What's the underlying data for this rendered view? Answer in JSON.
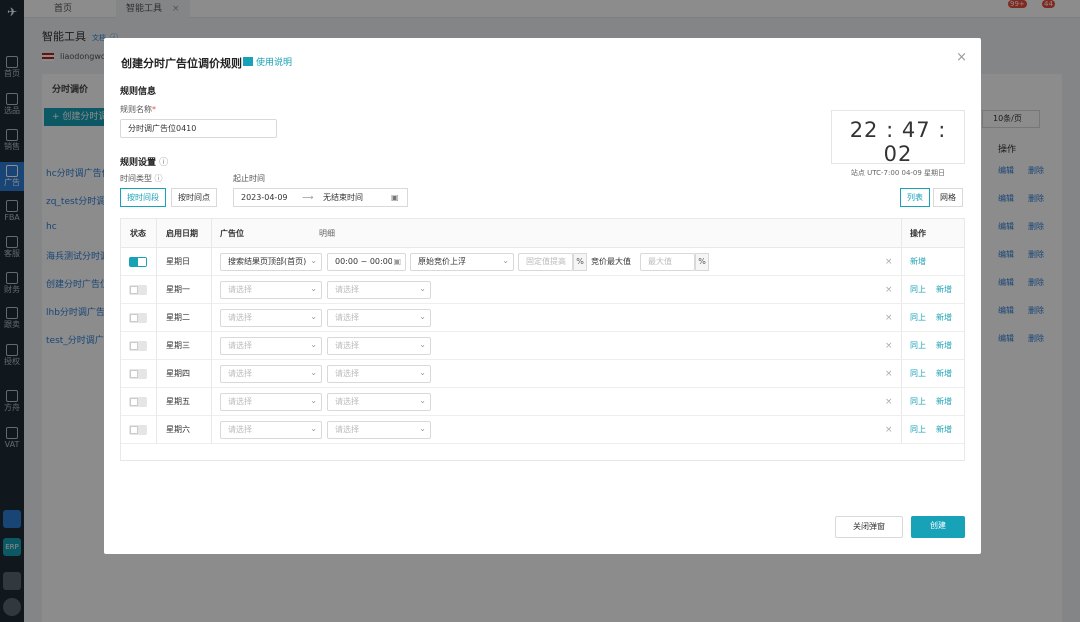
{
  "sidebar": {
    "items": [
      "首页",
      "选品",
      "销售",
      "广告",
      "FBA",
      "客服",
      "财务",
      "跟卖",
      "授权",
      "方舟",
      "VAT"
    ],
    "apps": [
      "ERP"
    ]
  },
  "tabs": [
    {
      "label": "首页"
    },
    {
      "label": "智能工具",
      "close": "×"
    }
  ],
  "badges": [
    "99+",
    "44"
  ],
  "background": {
    "title": "智能工具",
    "doc": "文档",
    "account": "liaodongwo",
    "card_title": "分时调价",
    "create": "+ 创建分时调",
    "rows": [
      "hc分时调广告位",
      "zq_test分时调",
      "hc",
      "海兵测试分时调",
      "创建分时广告位",
      "lhb分时调广告位",
      "test_分时调广告"
    ],
    "pager": "10条/页",
    "ops_header": "操作",
    "edit": "编辑",
    "delete": "删除"
  },
  "modal": {
    "title": "创建分时广告位调价规则",
    "help": "使用说明",
    "close": "×",
    "section_info": "规则信息",
    "name_label": "规则名称",
    "required_mark": "*",
    "name_value": "分时调广告位0410",
    "section_settings": "规则设置",
    "time_type_label": "时间类型",
    "period_label": "起止时间",
    "time_types": [
      "按时间段",
      "按时间点"
    ],
    "start_date": "2023-04-09",
    "arrow": "⟶",
    "end_date": "无结束时间",
    "clock": {
      "time": "22 : 47 : 02",
      "zone": "站点 UTC-7:00  04-09 星期日"
    },
    "view_modes": [
      "列表",
      "网格"
    ],
    "table": {
      "headers": {
        "status": "状态",
        "date": "启用日期",
        "placement": "广告位",
        "detail": "明细",
        "ops": "操作"
      },
      "first_row": {
        "day": "星期日",
        "placement": "搜索结果页顶部(首页)",
        "time": "00:00 ~ 00:00",
        "strategy": "原始竞价上浮",
        "fixed_placeholder": "固定值提高",
        "pct": "%",
        "max_label": "竞价最大值",
        "max_placeholder": "最大值"
      },
      "rows": [
        {
          "day": "星期一"
        },
        {
          "day": "星期二"
        },
        {
          "day": "星期三"
        },
        {
          "day": "星期四"
        },
        {
          "day": "星期五"
        },
        {
          "day": "星期六"
        }
      ],
      "placeholder": "请选择",
      "remove": "×",
      "add": "新增",
      "copy": "同上"
    },
    "cancel": "关闭弹窗",
    "submit": "创建"
  },
  "colors": {
    "accent": "#17a2b8",
    "link": "#2d7fd8",
    "sidebar": "#1e2a36"
  }
}
